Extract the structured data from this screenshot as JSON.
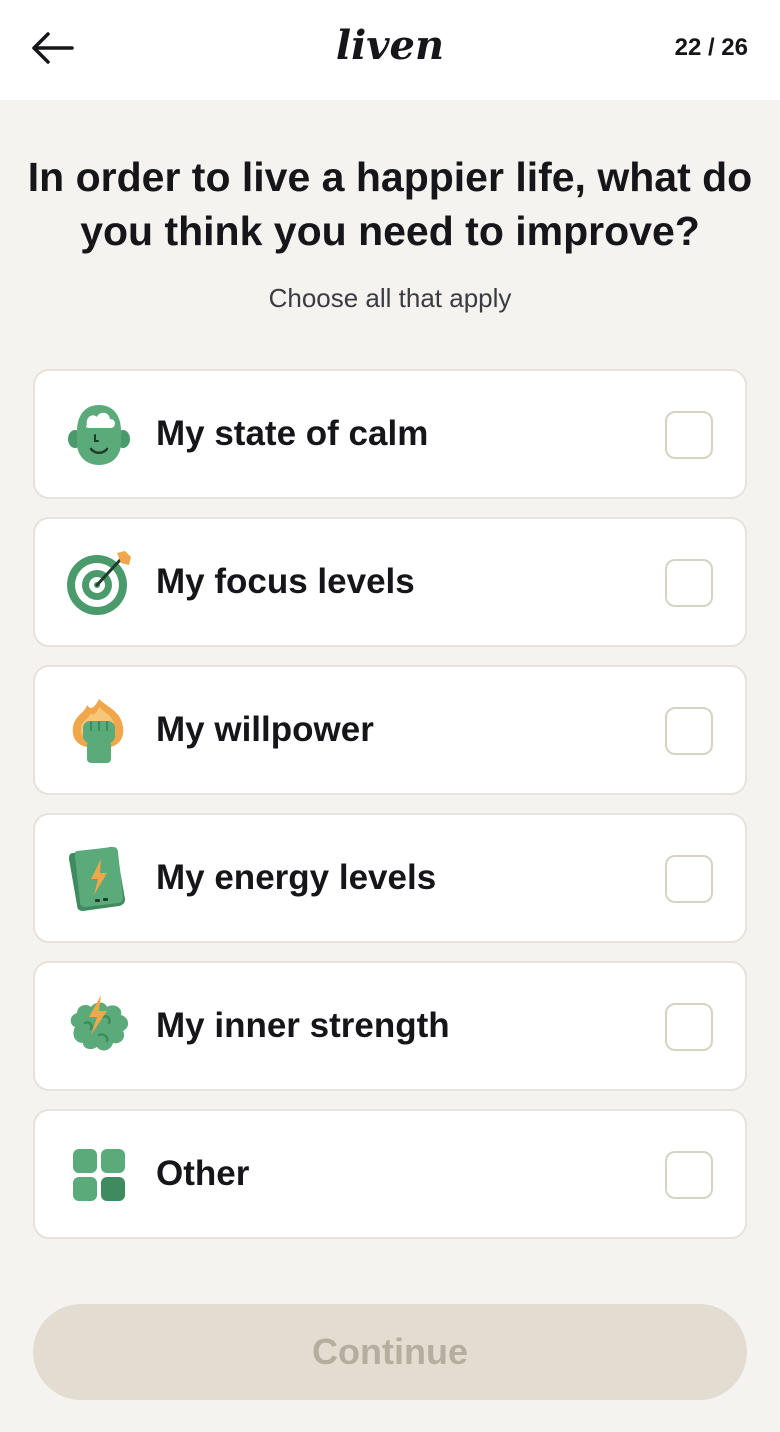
{
  "header": {
    "logo_text": "liven",
    "progress": "22 / 26",
    "back_icon": "arrow-left-icon"
  },
  "question": {
    "title": "In order to live a happier life, what do you think you need to improve?",
    "subtitle": "Choose all that apply"
  },
  "options": [
    {
      "label": "My state of calm",
      "icon": "calm-head-icon",
      "checked": false
    },
    {
      "label": "My focus levels",
      "icon": "target-icon",
      "checked": false
    },
    {
      "label": "My willpower",
      "icon": "fist-fire-icon",
      "checked": false
    },
    {
      "label": "My energy levels",
      "icon": "battery-bolt-icon",
      "checked": false
    },
    {
      "label": "My inner strength",
      "icon": "brain-bolt-icon",
      "checked": false
    },
    {
      "label": "Other",
      "icon": "grid-icon",
      "checked": false
    }
  ],
  "continue_button": {
    "label": "Continue",
    "disabled": true
  },
  "colors": {
    "accent_green": "#5aaa7a",
    "dark_green": "#3f8a5e",
    "flame_orange": "#f0a64a",
    "background": "#f5f3ef",
    "button_disabled_bg": "#e3ddd1",
    "button_disabled_text": "#b5ae9f"
  }
}
